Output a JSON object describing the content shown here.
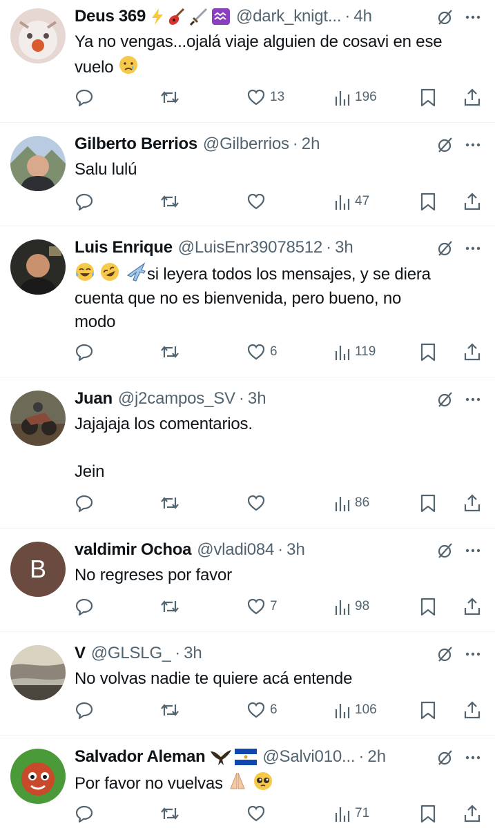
{
  "tweets": [
    {
      "name": "Deus 369",
      "handle": "@dark_knigt...",
      "time": "4h",
      "text": [
        "Ya no vengas...ojalá viaje alguien de cosavi en ese",
        "vuelo"
      ],
      "likes": "13",
      "views": "196",
      "name_emojis": [
        "high-voltage-emoji",
        "guitar-emoji",
        "dagger-emoji",
        "aquarius-emoji"
      ],
      "text_emojis": [
        "crying-face-emoji"
      ]
    },
    {
      "name": "Gilberto Berrios",
      "handle": "@Gilberrios",
      "time": "2h",
      "text": [
        "Salu lulú"
      ],
      "likes": "",
      "views": "47"
    },
    {
      "name": "Luis Enrique",
      "handle": "@LuisEnr39078512",
      "time": "3h",
      "text": [
        "si leyera todos los mensajes, y se diera",
        "cuenta que no es bienvenida, pero bueno, no",
        "modo"
      ],
      "likes": "6",
      "views": "119",
      "text_emojis": [
        "tears-of-joy-emoji",
        "rofl-emoji",
        "airplane-emoji"
      ]
    },
    {
      "name": "Juan",
      "handle": "@j2campos_SV",
      "time": "3h",
      "text": [
        "Jajajaja los comentarios.",
        "",
        "Jein"
      ],
      "likes": "",
      "views": "86"
    },
    {
      "name": "valdimir Ochoa",
      "handle": "@vladi084",
      "time": "3h",
      "text": [
        "No regreses por favor"
      ],
      "likes": "7",
      "views": "98",
      "avatar_letter": "B"
    },
    {
      "name": "V",
      "handle": "@GLSLG_",
      "time": "3h",
      "text": [
        "No volvas nadie te quiere acá entende"
      ],
      "likes": "6",
      "views": "106"
    },
    {
      "name": "Salvador Aleman",
      "handle": "@Salvi010...",
      "time": "2h",
      "text": [
        "Por favor no vuelvas"
      ],
      "likes": "",
      "views": "71",
      "name_emojis": [
        "eagle-emoji",
        "el-salvador-flag-emoji"
      ],
      "text_emojis": [
        "folded-hands-emoji",
        "pleading-face-emoji"
      ]
    }
  ],
  "separator": "·",
  "colors": {
    "text": "#0f1419",
    "secondary": "#536471",
    "divider": "#eff3f4",
    "avatar_b": "#6b4a3f"
  }
}
